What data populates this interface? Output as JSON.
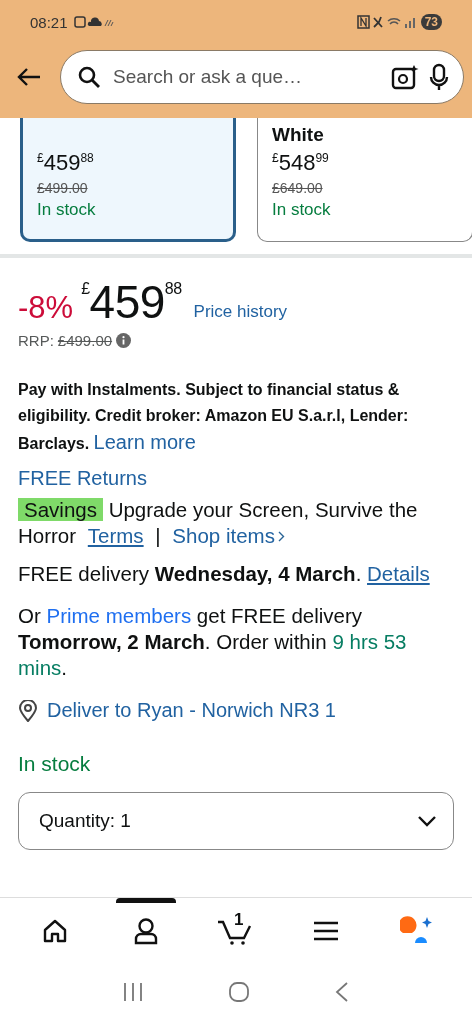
{
  "status_bar": {
    "time": "08:21",
    "battery": "73"
  },
  "search": {
    "placeholder": "Search or ask a que…"
  },
  "variants": [
    {
      "price_symbol": "£",
      "price_whole": "459",
      "price_fraction": "88",
      "was": "£499.00",
      "stock": "In stock",
      "selected": true
    },
    {
      "name": "White",
      "price_symbol": "£",
      "price_whole": "548",
      "price_fraction": "99",
      "was": "£649.00",
      "stock": "In stock",
      "selected": false
    }
  ],
  "price": {
    "discount": "-8%",
    "currency": "£",
    "whole": "459",
    "fraction": "88",
    "history_link": "Price history",
    "rrp_label": "RRP:",
    "rrp_value": "£499.00"
  },
  "instalments": {
    "text": "Pay with Instalments. Subject to financial status & eligibility. Credit broker: Amazon EU S.a.r.l, Lender: Barclays.",
    "link": "Learn more"
  },
  "returns": "FREE Returns",
  "savings": {
    "badge": "Savings",
    "text": "Upgrade your Screen, Survive the Horror",
    "terms_link": "Terms",
    "separator": "|",
    "shop_link": "Shop items"
  },
  "delivery": {
    "text": "FREE delivery **Wednesday, 4 March**.",
    "link": "Details"
  },
  "prime": [
    {
      "kind": "text",
      "text": "Or"
    },
    {
      "kind": "link",
      "text": "Prime members"
    },
    {
      "kind": "text",
      "text": "get FREE delivery **Tomorrow, 2 March**. Order within"
    },
    {
      "kind": "countdown",
      "text": "9 hrs 53 mins"
    },
    {
      "kind": "text",
      "text": "."
    }
  ],
  "location": "Deliver to Ryan - Norwich NR3 1",
  "stock": "In stock",
  "quantity": {
    "label": "Quantity:",
    "value": "1"
  },
  "bottom_nav": [
    {
      "kind": "home",
      "selected": false
    },
    {
      "kind": "account",
      "selected": true
    },
    {
      "kind": "cart",
      "badge": "1",
      "selected": false
    },
    {
      "kind": "menu",
      "selected": false
    },
    {
      "kind": "assistant",
      "selected": false
    }
  ]
}
